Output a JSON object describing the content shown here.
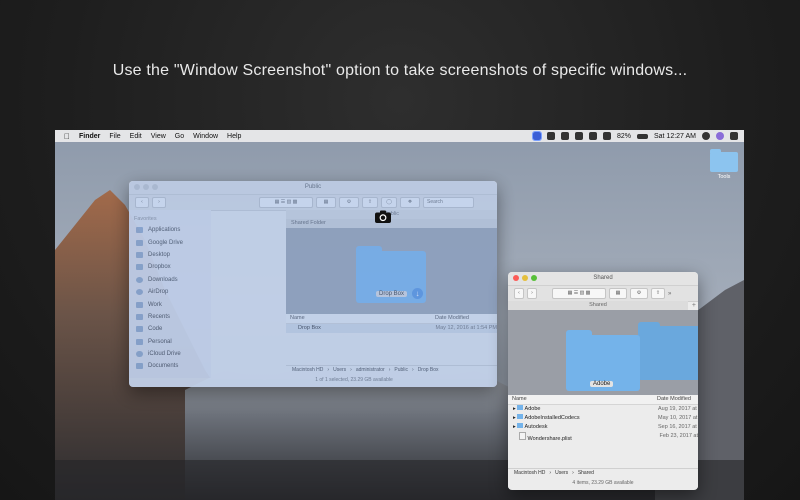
{
  "headline": "Use the \"Window Screenshot\" option to take screenshots of specific windows...",
  "menubar": {
    "app": "Finder",
    "items": [
      "File",
      "Edit",
      "View",
      "Go",
      "Window",
      "Help"
    ],
    "battery": "82%",
    "clock": "Sat 12:27 AM"
  },
  "desktop": {
    "folder_label": "Tools"
  },
  "window1": {
    "title": "Public",
    "search_placeholder": "Search",
    "path_tab": "Public",
    "preview_header": "Shared Folder",
    "preview_label": "Drop Box",
    "sidebar_header": "Favorites",
    "sidebar_items": [
      "Applications",
      "Google Drive",
      "Desktop",
      "Dropbox",
      "Downloads",
      "AirDrop",
      "Work",
      "Recents",
      "Code",
      "Personal",
      "iCloud Drive",
      "Documents"
    ],
    "col_name": "Name",
    "col_date": "Date Modified",
    "row_name": "Drop Box",
    "row_date": "May 12, 2016 at 1:54 PM",
    "path": [
      "Macintosh HD",
      "Users",
      "administrator",
      "Public",
      "Drop Box"
    ],
    "status": "1 of 1 selected, 23.29 GB available"
  },
  "window2": {
    "title": "Shared",
    "path_tab": "Shared",
    "preview_label": "Adobe",
    "col_name": "Name",
    "col_date": "Date Modified",
    "rows": [
      {
        "name": "Adobe",
        "date": "Aug 19, 2017 at"
      },
      {
        "name": "AdobeInstalledCodecs",
        "date": "May 10, 2017 at"
      },
      {
        "name": "Autodesk",
        "date": "Sep 16, 2017 at"
      },
      {
        "name": "Wondershare.plist",
        "date": "Feb 23, 2017 at"
      }
    ],
    "path": [
      "Macintosh HD",
      "Users",
      "Shared"
    ],
    "status": "4 items, 23.29 GB available"
  },
  "colors": {
    "selection_overlay": "#78a0e1",
    "folder_blue": "#74b3ea"
  }
}
